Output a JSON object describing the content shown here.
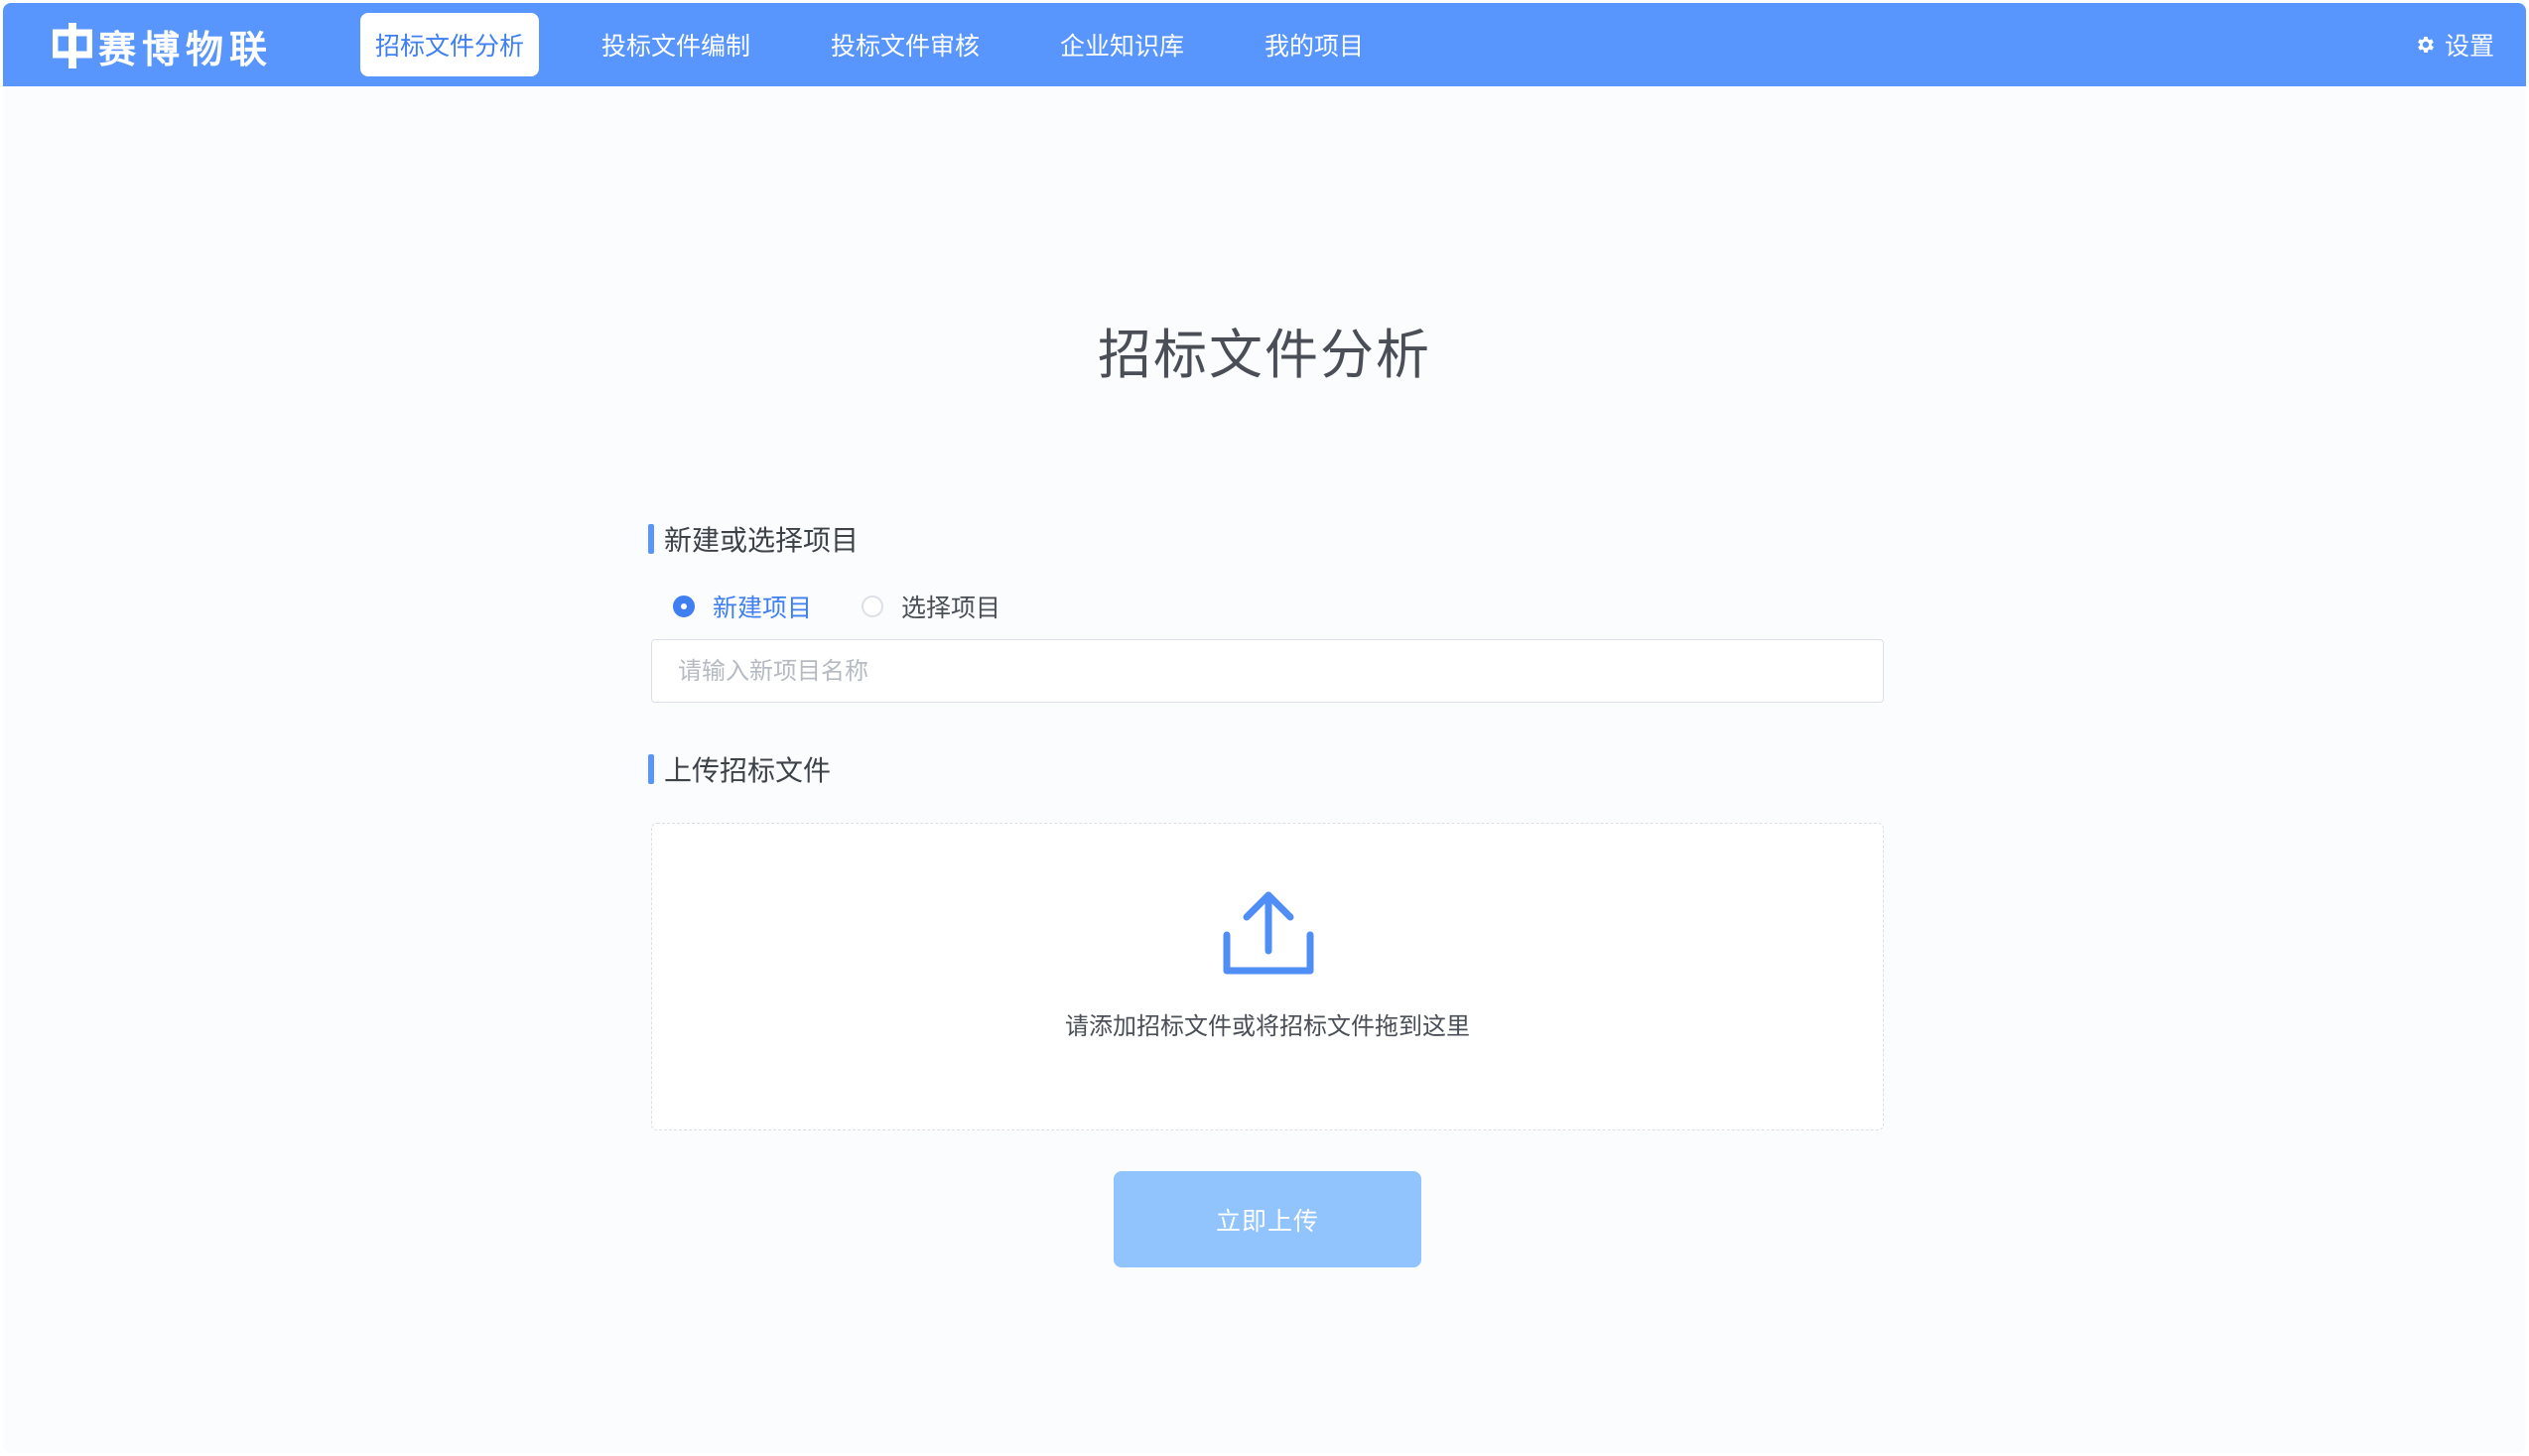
{
  "brand": {
    "logo_text": "赛博物联",
    "logo_icon": "zhong-logo-icon"
  },
  "nav": {
    "items": [
      {
        "label": "招标文件分析",
        "active": true
      },
      {
        "label": "投标文件编制",
        "active": false
      },
      {
        "label": "投标文件审核",
        "active": false
      },
      {
        "label": "企业知识库",
        "active": false
      },
      {
        "label": "我的项目",
        "active": false
      }
    ],
    "settings_label": "设置",
    "settings_icon": "gear-icon"
  },
  "page": {
    "title": "招标文件分析"
  },
  "project_section": {
    "heading": "新建或选择项目",
    "options": [
      {
        "label": "新建项目",
        "checked": true
      },
      {
        "label": "选择项目",
        "checked": false
      }
    ],
    "name_input": {
      "value": "",
      "placeholder": "请输入新项目名称"
    }
  },
  "upload_section": {
    "heading": "上传招标文件",
    "icon": "upload-icon",
    "hint": "请添加招标文件或将招标文件拖到这里"
  },
  "submit": {
    "label": "立即上传"
  },
  "colors": {
    "primary": "#5895fc",
    "active_text": "#3f7ff2",
    "button_disabled": "#91c3fd",
    "background": "#fbfcfe"
  }
}
